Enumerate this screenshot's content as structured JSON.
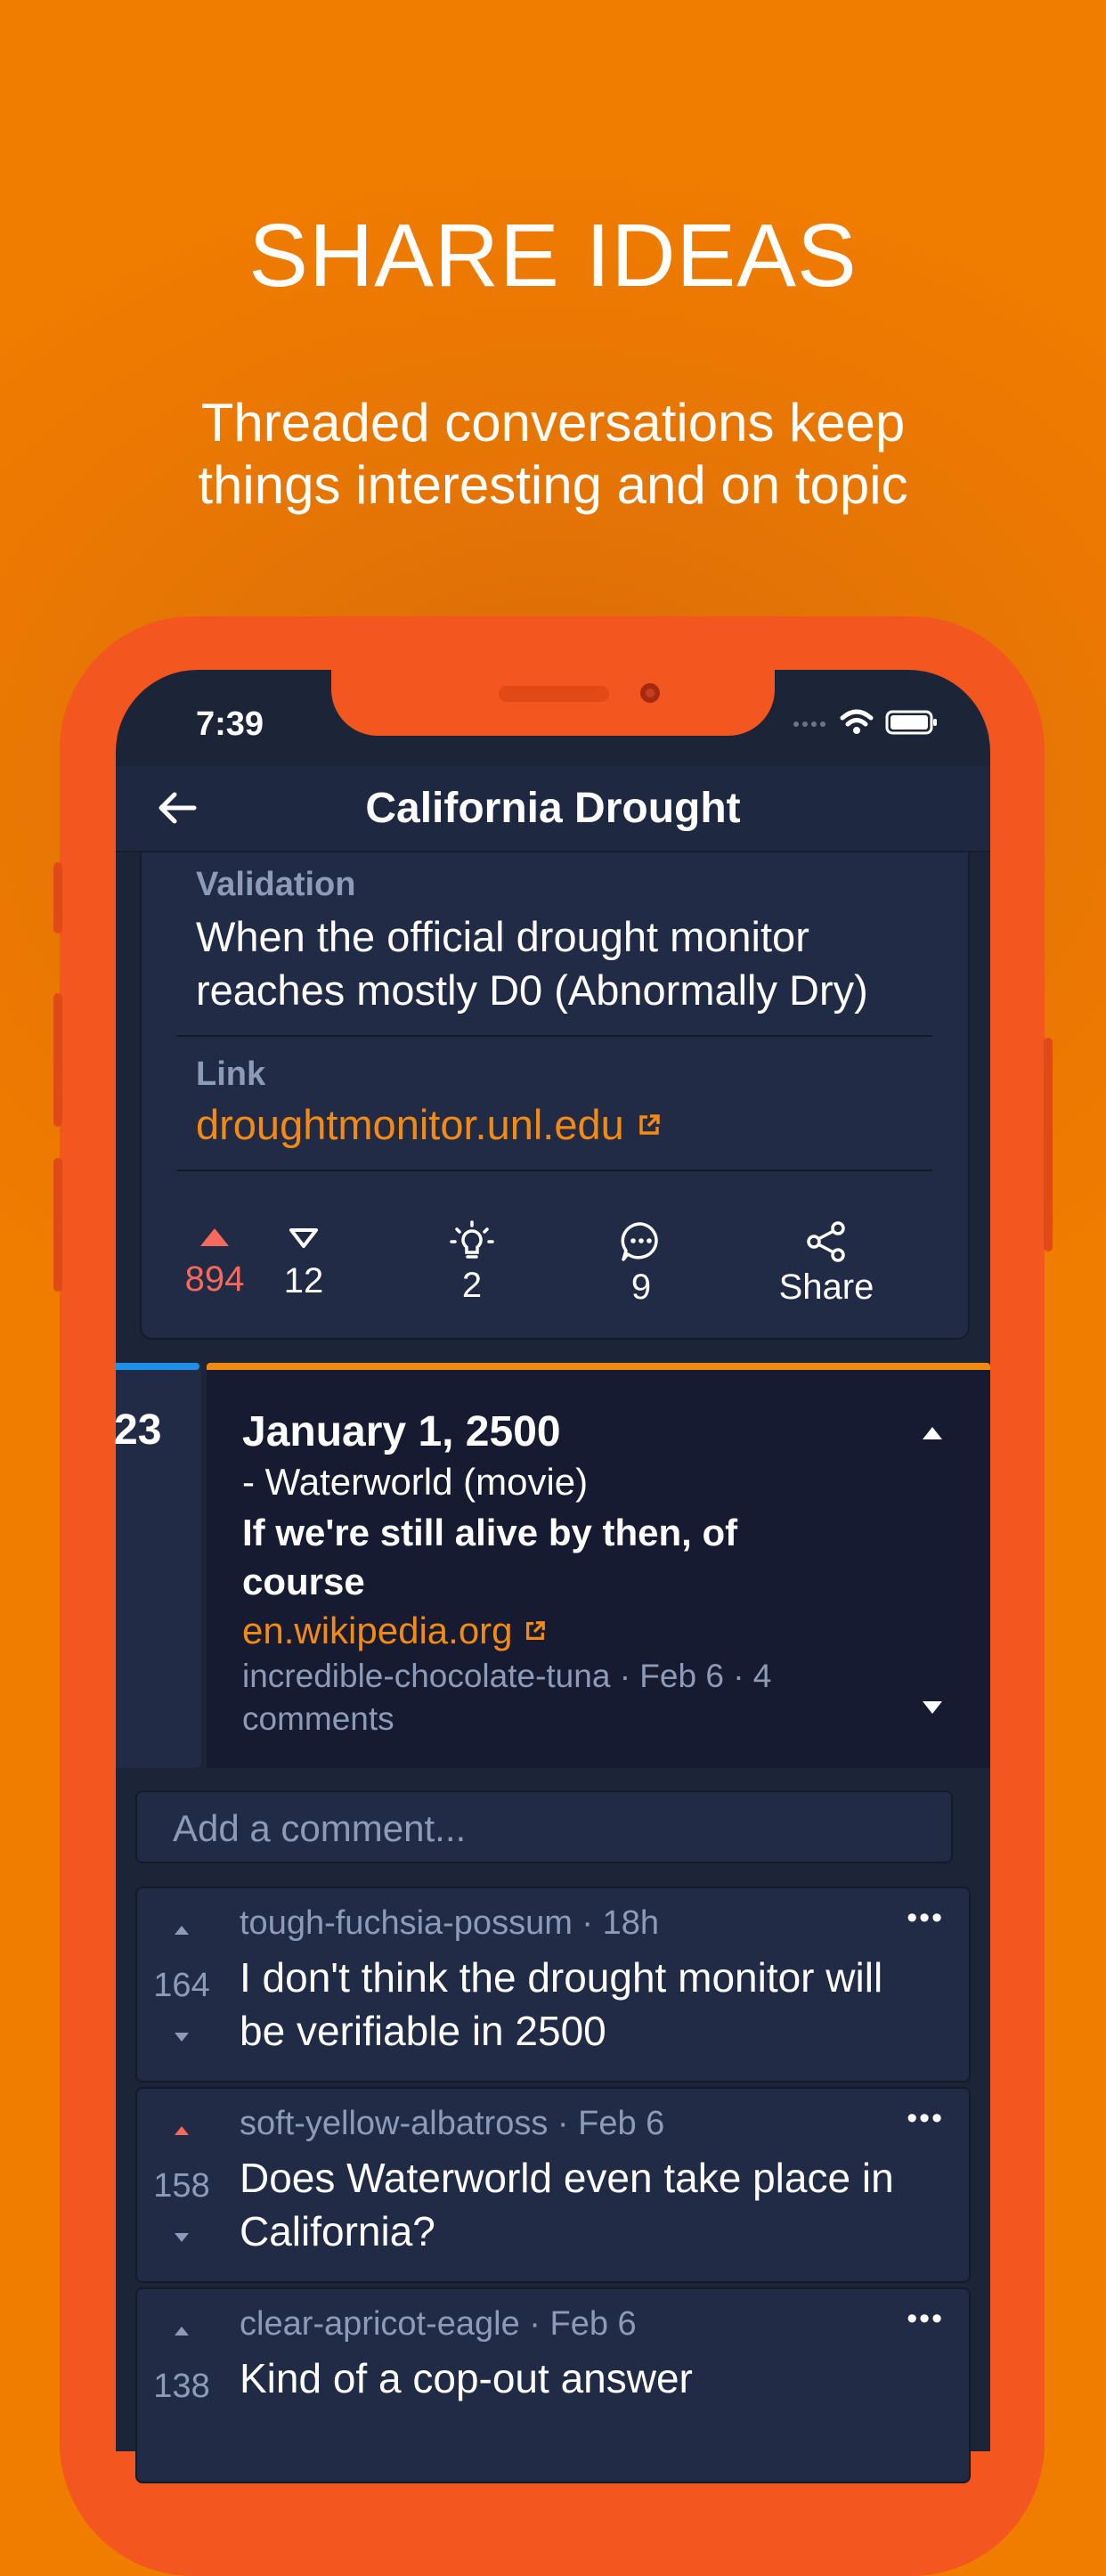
{
  "promo": {
    "headline": "SHARE IDEAS",
    "subline_1": "Threaded conversations keep",
    "subline_2": "things interesting and on topic"
  },
  "status_bar": {
    "time": "7:39"
  },
  "nav": {
    "title": "California Drought"
  },
  "prediction": {
    "validation_label": "Validation",
    "validation_line_1": "When the official drought monitor",
    "validation_line_2": "reaches mostly D0 (Abnormally Dry)",
    "link_label": "Link",
    "link_text": "droughtmonitor.unl.edu",
    "actions": {
      "upvotes": "894",
      "downvotes": "12",
      "ideas": "2",
      "comments": "9",
      "share": "Share"
    }
  },
  "thread": {
    "side_number": "23",
    "title": "January 1, 2500",
    "source": "- Waterworld (movie)",
    "note_line_1": "If we're still alive by then, of",
    "note_line_2": "course",
    "link_text": "en.wikipedia.org",
    "meta_line_1": "incredible-chocolate-tuna · Feb 6 · 4",
    "meta_line_2": "comments"
  },
  "comment_input": {
    "placeholder": "Add a comment..."
  },
  "comments": [
    {
      "meta": "tough-fuchsia-possum · 18h",
      "line_1": "I don't think the drought monitor will",
      "line_2": "be verifiable in 2500",
      "votes": "164",
      "upvoted": false
    },
    {
      "meta": "soft-yellow-albatross · Feb 6",
      "line_1": "Does Waterworld even take place in",
      "line_2": "California?",
      "votes": "158",
      "upvoted": true
    },
    {
      "meta": "clear-apricot-eagle · Feb 6",
      "line_1": "Kind of a cop-out answer",
      "line_2": "",
      "votes": "138",
      "upvoted": false
    }
  ],
  "colors": {
    "accent": "#f38a12",
    "upvote_active": "#f56a5c",
    "background_orange": "#f07c00",
    "phone_frame": "#f3561f",
    "screen_bg": "#1c2438"
  },
  "icons": [
    "back-arrow-icon",
    "wifi-icon",
    "battery-icon",
    "external-link-icon",
    "upvote-icon",
    "downvote-icon",
    "lightbulb-icon",
    "comment-icon",
    "share-icon",
    "more-icon"
  ]
}
